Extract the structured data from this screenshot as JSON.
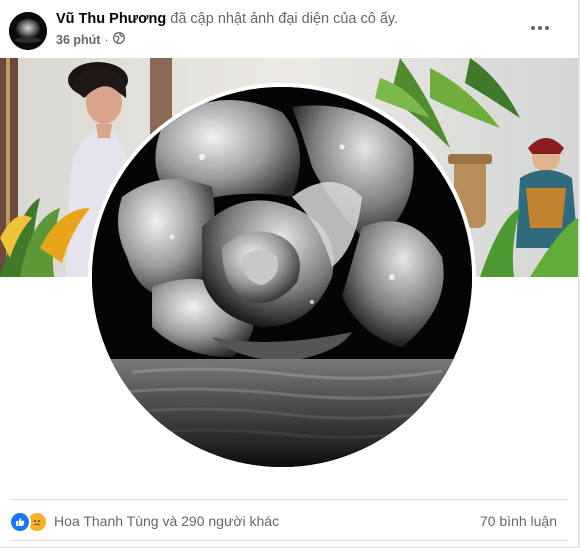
{
  "post": {
    "author": "Vũ Thu Phương",
    "action": "đã cập nhật ảnh đại diện của cô ấy.",
    "time": "36 phút",
    "privacy_icon": "globe-icon"
  },
  "stats": {
    "reactors": "Hoa Thanh Tùng và 290 người khác",
    "comments": "70 bình luận",
    "reaction_icons": [
      "like-icon",
      "sad-icon"
    ]
  },
  "colors": {
    "like": "#1877f2",
    "sad": "#f7b125",
    "secondary_text": "#65676b",
    "primary_text": "#050505"
  }
}
